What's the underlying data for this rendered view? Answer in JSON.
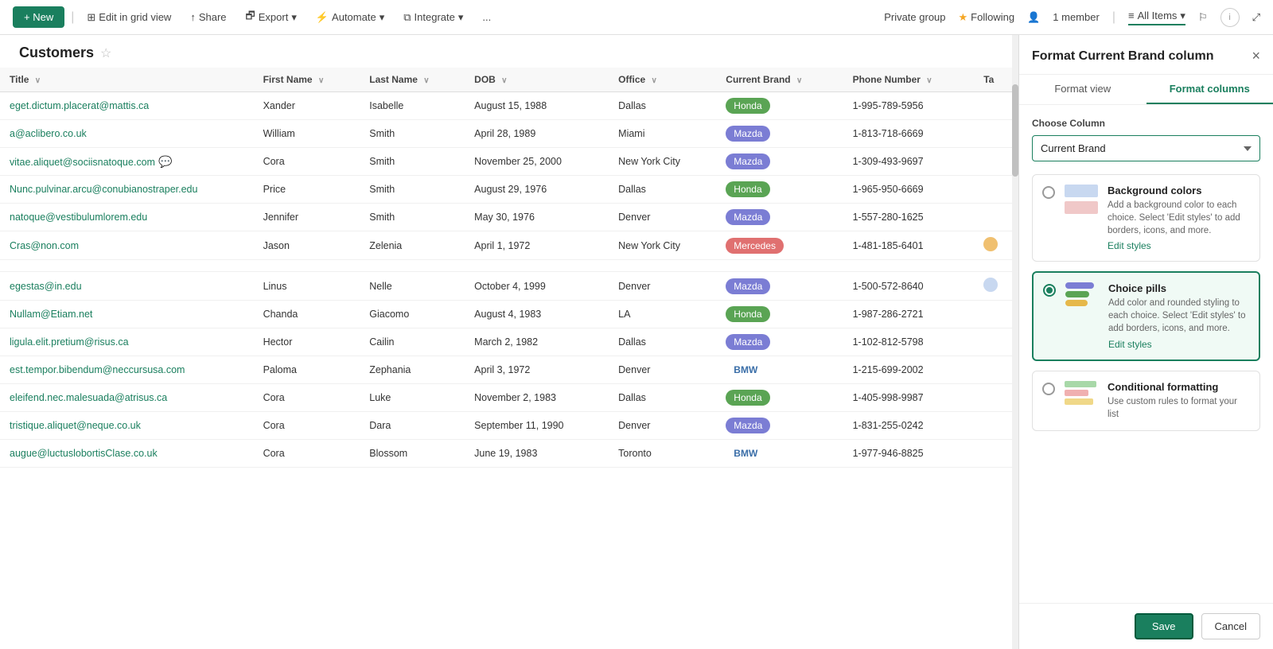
{
  "header": {
    "new_label": "+ New",
    "edit_grid_label": "Edit in grid view",
    "share_label": "Share",
    "export_label": "Export",
    "automate_label": "Automate",
    "integrate_label": "Integrate",
    "more_label": "...",
    "private_group_label": "Private group",
    "following_label": "Following",
    "member_label": "1 member",
    "all_items_label": "All Items"
  },
  "page": {
    "title": "Customers",
    "star": "☆"
  },
  "table": {
    "columns": [
      "Title",
      "First Name",
      "Last Name",
      "DOB",
      "Office",
      "Current Brand",
      "Phone Number",
      "Ta"
    ],
    "rows": [
      {
        "title": "eget.dictum.placerat@mattis.ca",
        "first_name": "Xander",
        "last_name": "Isabelle",
        "dob": "August 15, 1988",
        "office": "Dallas",
        "brand": "Honda",
        "brand_class": "honda",
        "phone": "1-995-789-5956"
      },
      {
        "title": "a@aclibero.co.uk",
        "first_name": "William",
        "last_name": "Smith",
        "dob": "April 28, 1989",
        "office": "Miami",
        "brand": "Mazda",
        "brand_class": "mazda",
        "phone": "1-813-718-6669"
      },
      {
        "title": "vitae.aliquet@sociisnatoque.com",
        "first_name": "Cora",
        "last_name": "Smith",
        "dob": "November 25, 2000",
        "office": "New York City",
        "brand": "Mazda",
        "brand_class": "mazda",
        "phone": "1-309-493-9697",
        "has_chat": true
      },
      {
        "title": "Nunc.pulvinar.arcu@conubianostraper.edu",
        "first_name": "Price",
        "last_name": "Smith",
        "dob": "August 29, 1976",
        "office": "Dallas",
        "brand": "Honda",
        "brand_class": "honda",
        "phone": "1-965-950-6669"
      },
      {
        "title": "natoque@vestibulumlorem.edu",
        "first_name": "Jennifer",
        "last_name": "Smith",
        "dob": "May 30, 1976",
        "office": "Denver",
        "brand": "Mazda",
        "brand_class": "mazda",
        "phone": "1-557-280-1625"
      },
      {
        "title": "Cras@non.com",
        "first_name": "Jason",
        "last_name": "Zelenia",
        "dob": "April 1, 1972",
        "office": "New York City",
        "brand": "Mercedes",
        "brand_class": "mercedes",
        "phone": "1-481-185-6401"
      },
      {
        "title": "",
        "first_name": "",
        "last_name": "",
        "dob": "",
        "office": "",
        "brand": "",
        "brand_class": "",
        "phone": ""
      },
      {
        "title": "egestas@in.edu",
        "first_name": "Linus",
        "last_name": "Nelle",
        "dob": "October 4, 1999",
        "office": "Denver",
        "brand": "Mazda",
        "brand_class": "mazda",
        "phone": "1-500-572-8640"
      },
      {
        "title": "Nullam@Etiam.net",
        "first_name": "Chanda",
        "last_name": "Giacomo",
        "dob": "August 4, 1983",
        "office": "LA",
        "brand": "Honda",
        "brand_class": "honda",
        "phone": "1-987-286-2721"
      },
      {
        "title": "ligula.elit.pretium@risus.ca",
        "first_name": "Hector",
        "last_name": "Cailin",
        "dob": "March 2, 1982",
        "office": "Dallas",
        "brand": "Mazda",
        "brand_class": "mazda",
        "phone": "1-102-812-5798"
      },
      {
        "title": "est.tempor.bibendum@neccursusa.com",
        "first_name": "Paloma",
        "last_name": "Zephania",
        "dob": "April 3, 1972",
        "office": "Denver",
        "brand": "BMW",
        "brand_class": "bmw",
        "phone": "1-215-699-2002"
      },
      {
        "title": "eleifend.nec.malesuada@atrisus.ca",
        "first_name": "Cora",
        "last_name": "Luke",
        "dob": "November 2, 1983",
        "office": "Dallas",
        "brand": "Honda",
        "brand_class": "honda",
        "phone": "1-405-998-9987"
      },
      {
        "title": "tristique.aliquet@neque.co.uk",
        "first_name": "Cora",
        "last_name": "Dara",
        "dob": "September 11, 1990",
        "office": "Denver",
        "brand": "Mazda",
        "brand_class": "mazda",
        "phone": "1-831-255-0242"
      },
      {
        "title": "augue@luctuslobortisClase.co.uk",
        "first_name": "Cora",
        "last_name": "Blossom",
        "dob": "June 19, 1983",
        "office": "Toronto",
        "brand": "BMW",
        "brand_class": "bmw",
        "phone": "1-977-946-8825"
      }
    ]
  },
  "panel": {
    "title": "Format Current Brand column",
    "close_label": "×",
    "tab_view": "Format view",
    "tab_columns": "Format columns",
    "choose_column_label": "Choose Column",
    "column_value": "Current Brand",
    "options": [
      {
        "id": "background",
        "title": "Background colors",
        "description": "Add a background color to each choice. Select 'Edit styles' to add borders, icons, and more.",
        "edit_link": "Edit styles",
        "selected": false
      },
      {
        "id": "choice_pills",
        "title": "Choice pills",
        "description": "Add color and rounded styling to each choice. Select 'Edit styles' to add borders, icons, and more.",
        "edit_link": "Edit styles",
        "selected": true
      },
      {
        "id": "conditional",
        "title": "Conditional formatting",
        "description": "Use custom rules to format your list",
        "edit_link": "",
        "selected": false
      }
    ],
    "save_label": "Save",
    "cancel_label": "Cancel"
  }
}
